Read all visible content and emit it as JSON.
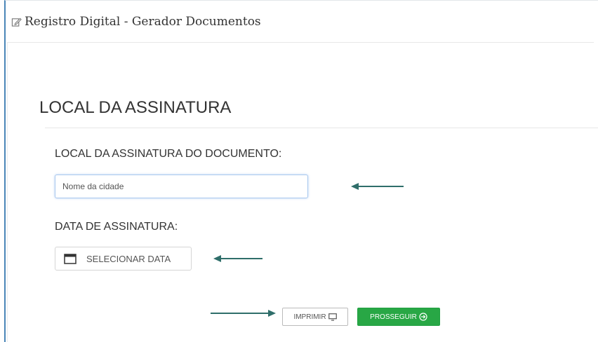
{
  "window": {
    "title": "Registro Digital - Gerador Documentos",
    "icon": "edit-icon"
  },
  "section": {
    "title": "LOCAL DA ASSINATURA"
  },
  "form": {
    "location_label": "LOCAL DA ASSINATURA DO DOCUMENTO:",
    "location_placeholder": "Nome da cidade",
    "date_label": "DATA DE ASSINATURA:",
    "date_button_label": "SELECIONAR DATA",
    "date_icon": "calendar-icon"
  },
  "actions": {
    "print_label": "IMPRIMIR",
    "print_icon": "monitor-icon",
    "next_label": "PROSSEGUIR",
    "next_icon": "arrow-circle-right-icon",
    "next_color": "#28a745"
  },
  "annotations": {
    "arrow_color": "#2f6e6a"
  }
}
